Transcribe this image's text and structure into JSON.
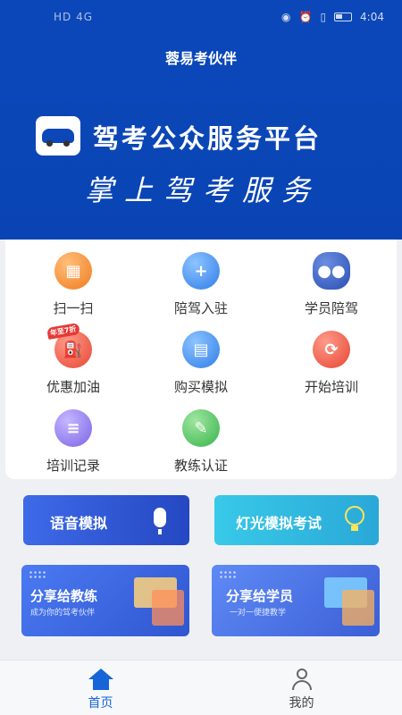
{
  "status_bar": {
    "left_text": "HD 4G",
    "time": "4:04"
  },
  "header": {
    "title": "蓉易考伙伴"
  },
  "banner": {
    "title": "驾考公众服务平台",
    "subtitle": "掌上驾考服务"
  },
  "grid": [
    {
      "label": "扫一扫",
      "icon": "scan-icon",
      "color": "#f0791e"
    },
    {
      "label": "陪驾入驻",
      "icon": "add-user-icon",
      "color": "#2e7ce8"
    },
    {
      "label": "学员陪驾",
      "icon": "users-icon",
      "color": "#2a4fb5"
    },
    {
      "label": "优惠加油",
      "icon": "fuel-icon",
      "color": "#e6452f",
      "tag": "年至7折"
    },
    {
      "label": "购买模拟",
      "icon": "document-icon",
      "color": "#2e7ce8"
    },
    {
      "label": "开始培训",
      "icon": "refresh-icon",
      "color": "#e6452f"
    },
    {
      "label": "培训记录",
      "icon": "list-icon",
      "color": "#7a63e6"
    },
    {
      "label": "教练认证",
      "icon": "certificate-icon",
      "color": "#36b34a"
    }
  ],
  "actions": {
    "voice": {
      "label": "语音模拟",
      "icon": "microphone-icon"
    },
    "light": {
      "label": "灯光模拟考试",
      "icon": "lightbulb-icon"
    }
  },
  "share": {
    "coach": {
      "title": "分享给教练",
      "subtitle": "成为你的驾考伙伴"
    },
    "student": {
      "title": "分享给学员",
      "subtitle": "一对一便捷教学"
    }
  },
  "tabbar": {
    "home": {
      "label": "首页",
      "icon": "home-icon"
    },
    "mine": {
      "label": "我的",
      "icon": "user-icon"
    }
  }
}
